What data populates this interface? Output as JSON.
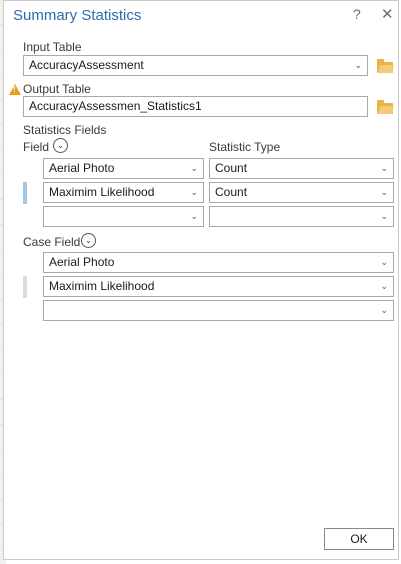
{
  "dialog": {
    "title": "Summary Statistics",
    "help_label": "?",
    "close_label": "✕"
  },
  "input_table": {
    "label": "Input Table",
    "value": "AccuracyAssessment"
  },
  "output_table": {
    "label": "Output Table",
    "value": "AccuracyAssessmen_Statistics1"
  },
  "statistics_fields": {
    "label": "Statistics Fields",
    "field_header": "Field",
    "type_header": "Statistic Type",
    "rows": [
      {
        "field": "Aerial Photo",
        "type": "Count"
      },
      {
        "field": "Maximim Likelihood",
        "type": "Count"
      },
      {
        "field": "",
        "type": ""
      }
    ]
  },
  "case_field": {
    "label": "Case Field",
    "rows": [
      "Aerial Photo",
      "Maximim Likelihood",
      ""
    ]
  },
  "ok_label": "OK",
  "icons": {
    "dropdown": "chevron-down-icon",
    "folder": "folder-open-icon",
    "warning": "warning-icon"
  },
  "colors": {
    "title": "#2b6cb0",
    "folder": "#e7b44b",
    "warning": "#e3a019",
    "row_marker_selected": "#9fc7e6"
  }
}
